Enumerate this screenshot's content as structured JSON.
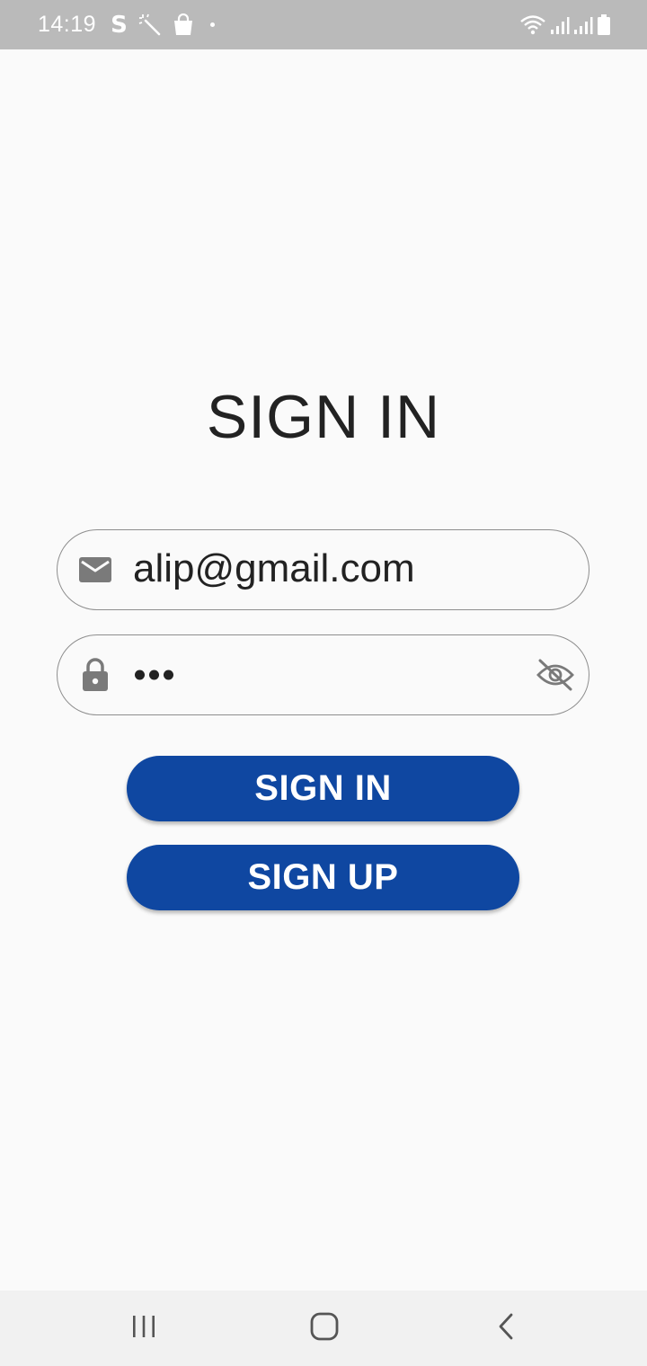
{
  "status_bar": {
    "time": "14:19",
    "left_icons": [
      "s-icon",
      "magic-wand-icon",
      "shopping-bag-icon",
      "dot-icon"
    ],
    "right_icons": [
      "wifi-icon",
      "signal-icon",
      "signal-icon",
      "battery-icon"
    ],
    "s_label": "S"
  },
  "page": {
    "title": "SIGN IN"
  },
  "form": {
    "email": {
      "icon": "email-icon",
      "value": "alip@gmail.com"
    },
    "password": {
      "icon": "lock-icon",
      "masked_length": 3,
      "toggle_icon": "eye-off-icon"
    },
    "sign_in_label": "SIGN IN",
    "sign_up_label": "SIGN UP"
  },
  "nav_bar": {
    "buttons": [
      "recents-icon",
      "home-icon",
      "back-icon"
    ]
  },
  "colors": {
    "primary": "#0f47a1",
    "background": "#fafafa",
    "status_bar": "#bababa",
    "nav_bar": "#f1f1f1",
    "field_border": "#8e8e8e",
    "icon_gray": "#7a7a7a"
  }
}
